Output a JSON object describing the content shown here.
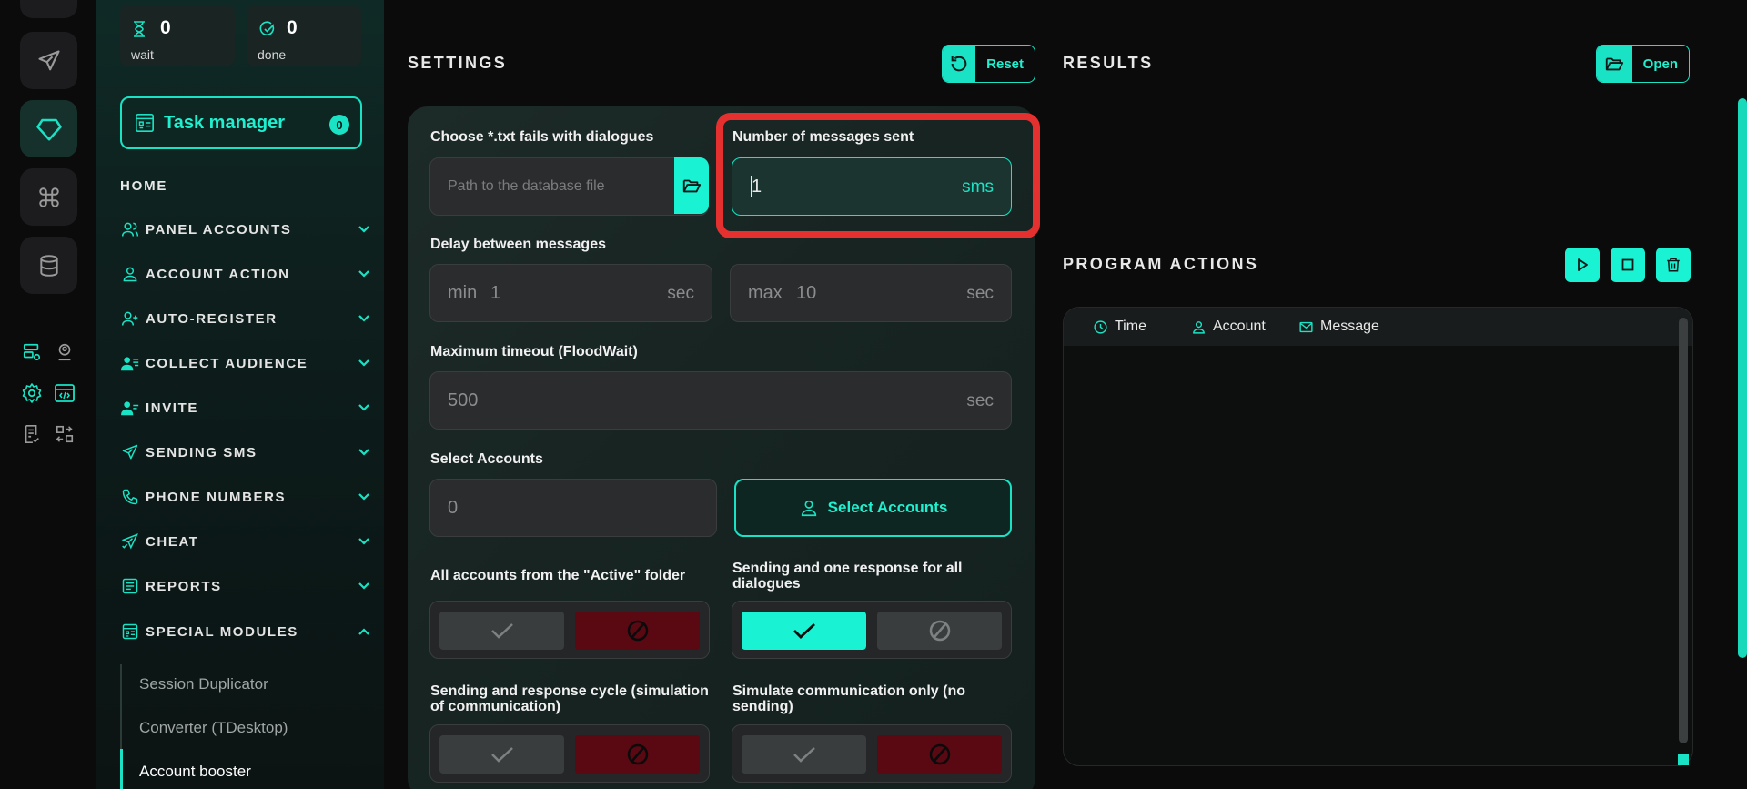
{
  "stats": {
    "wait": {
      "count": "0",
      "label": "wait"
    },
    "done": {
      "count": "0",
      "label": "done"
    }
  },
  "task_manager": {
    "label": "Task manager",
    "count": "0"
  },
  "nav": {
    "home": "HOME",
    "items": [
      {
        "label": "PANEL ACCOUNTS"
      },
      {
        "label": "ACCOUNT ACTION"
      },
      {
        "label": "AUTO-REGISTER"
      },
      {
        "label": "COLLECT AUDIENCE"
      },
      {
        "label": "INVITE"
      },
      {
        "label": "SENDING SMS"
      },
      {
        "label": "PHONE NUMBERS"
      },
      {
        "label": "CHEAT"
      },
      {
        "label": "REPORTS"
      },
      {
        "label": "SPECIAL MODULES"
      }
    ],
    "sub_items": [
      "Session Duplicator",
      "Converter (TDesktop)",
      "Account booster"
    ]
  },
  "settings": {
    "title": "SETTINGS",
    "reset_label": "Reset",
    "file": {
      "label": "Choose *.txt fails with dialogues",
      "placeholder": "Path to the database file"
    },
    "messages": {
      "label": "Number of messages sent",
      "value": "1",
      "unit": "sms"
    },
    "delay": {
      "label": "Delay between messages",
      "min_prefix": "min",
      "min_value": "1",
      "max_prefix": "max",
      "max_value": "10",
      "unit": "sec"
    },
    "timeout": {
      "label": "Maximum timeout (FloodWait)",
      "value": "500",
      "unit": "sec"
    },
    "accounts": {
      "label": "Select Accounts",
      "value": "0",
      "button": "Select Accounts"
    },
    "toggles": {
      "active_folder": "All accounts from the \"Active\" folder",
      "one_response": "Sending and one response for all dialogues",
      "cycle": "Sending and response cycle (simulation of communication)",
      "simulate_only": "Simulate communication only (no sending)"
    }
  },
  "results": {
    "title": "RESULTS",
    "open_label": "Open"
  },
  "program_actions": {
    "title": "PROGRAM ACTIONS",
    "columns": [
      "Time",
      "Account",
      "Message"
    ]
  },
  "colors": {
    "accent": "#19e3c4",
    "danger": "#5a0812",
    "highlight": "#e4312f"
  }
}
